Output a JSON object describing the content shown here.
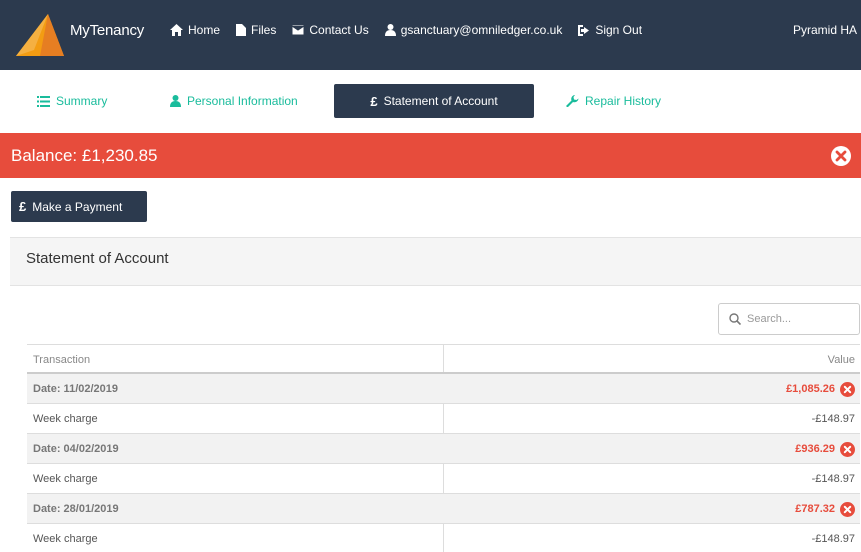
{
  "navbar": {
    "brand": "MyTenancy",
    "links": [
      {
        "label": "Home",
        "icon": "home-icon"
      },
      {
        "label": "Files",
        "icon": "file-icon"
      },
      {
        "label": "Contact Us",
        "icon": "envelope-icon"
      },
      {
        "label": "gsanctuary@omniledger.co.uk",
        "icon": "user-icon"
      },
      {
        "label": "Sign Out",
        "icon": "sign-out-icon"
      }
    ],
    "right_text": "Pyramid HA"
  },
  "tabs": [
    {
      "label": "Summary",
      "icon": "list-icon"
    },
    {
      "label": "Personal Information",
      "icon": "user-icon"
    },
    {
      "label": "Statement of Account",
      "icon": "pound-icon",
      "symbol": "£"
    },
    {
      "label": "Repair History",
      "icon": "wrench-icon"
    }
  ],
  "balance": {
    "text": "Balance: £1,230.85"
  },
  "payment_button": {
    "symbol": "£",
    "label": "Make a Payment"
  },
  "panel": {
    "title": "Statement of Account"
  },
  "search": {
    "placeholder": "Search..."
  },
  "table": {
    "headers": [
      "Transaction",
      "Value"
    ],
    "rows": [
      {
        "type": "date",
        "label": "Date: 11/02/2019",
        "value": "£1,085.26"
      },
      {
        "type": "charge",
        "label": "Week charge",
        "value": "-£148.97"
      },
      {
        "type": "date",
        "label": "Date: 04/02/2019",
        "value": "£936.29"
      },
      {
        "type": "charge",
        "label": "Week charge",
        "value": "-£148.97"
      },
      {
        "type": "date",
        "label": "Date: 28/01/2019",
        "value": "£787.32"
      },
      {
        "type": "charge",
        "label": "Week charge",
        "value": "-£148.97"
      }
    ]
  },
  "colors": {
    "navbar": "#2c3a4e",
    "accent": "#1abc9c",
    "danger": "#e74c3c"
  }
}
